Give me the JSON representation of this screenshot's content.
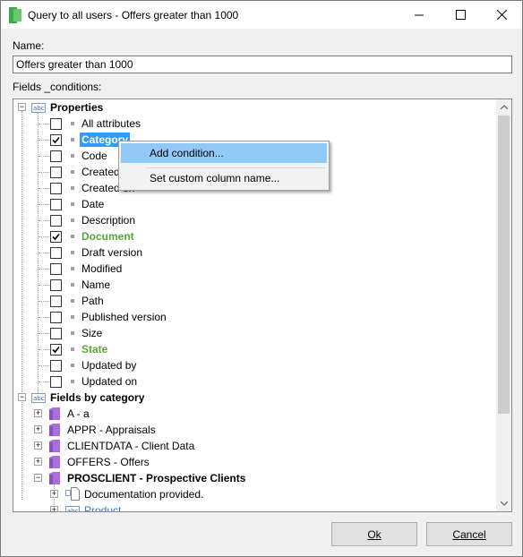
{
  "window": {
    "title": "Query to all users - Offers greater than 1000",
    "name_label": "Name:",
    "fields_label": "Fields _conditions:"
  },
  "name_field": {
    "value": "Offers greater than 1000"
  },
  "tree": {
    "properties": {
      "label": "Properties",
      "items": [
        {
          "label": "All attributes",
          "checked": false
        },
        {
          "label": "Category",
          "checked": true
        },
        {
          "label": "Code",
          "checked": false
        },
        {
          "label": "Created",
          "checked": false
        },
        {
          "label": "Created on",
          "checked": false
        },
        {
          "label": "Date",
          "checked": false
        },
        {
          "label": "Description",
          "checked": false
        },
        {
          "label": "Document",
          "checked": true
        },
        {
          "label": "Draft version",
          "checked": false
        },
        {
          "label": "Modified",
          "checked": false
        },
        {
          "label": "Name",
          "checked": false
        },
        {
          "label": "Path",
          "checked": false
        },
        {
          "label": "Published version",
          "checked": false
        },
        {
          "label": "Size",
          "checked": false
        },
        {
          "label": "State",
          "checked": true
        },
        {
          "label": "Updated by",
          "checked": false
        },
        {
          "label": "Updated on",
          "checked": false
        }
      ]
    },
    "fields_by_category": {
      "label": "Fields by category",
      "categories": [
        {
          "label": "A - a"
        },
        {
          "label": "APPR -  Appraisals"
        },
        {
          "label": "CLIENTDATA - Client Data"
        },
        {
          "label": "OFFERS - Offers"
        },
        {
          "label": "PROSCLIENT - Prospective Clients"
        }
      ],
      "prosclient_children": [
        {
          "label": "Documentation provided."
        },
        {
          "label": "Product"
        }
      ]
    }
  },
  "context_menu": {
    "items": [
      {
        "label": "Add condition..."
      },
      {
        "label": "Set custom column name..."
      }
    ]
  },
  "buttons": {
    "ok": {
      "label": "Ok"
    },
    "cancel": {
      "label": "Cancel"
    }
  },
  "colors": {
    "selection": "#3399ff",
    "checked_item": "#5aa63a",
    "menu_highlight": "#91c9f7",
    "folder": "#a870d8"
  }
}
